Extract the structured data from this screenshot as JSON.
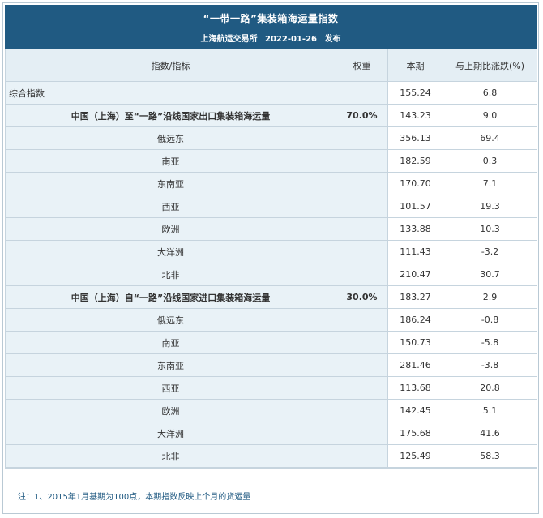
{
  "header": {
    "title": "“一带一路”集装箱海运量指数",
    "publisher": "上海航运交易所",
    "date": "2022-01-26",
    "action": "发布"
  },
  "table": {
    "columns": [
      "指数/指标",
      "权重",
      "本期",
      "与上期比涨跌(%)"
    ],
    "composite": {
      "name": "综合指数",
      "value": "155.24",
      "change": "6.8"
    },
    "groups": [
      {
        "name": "中国（上海）至“一路”沿线国家出口集装箱海运量",
        "weight": "70.0%",
        "value": "143.23",
        "change": "9.0",
        "rows": [
          {
            "name": "俄远东",
            "value": "356.13",
            "change": "69.4"
          },
          {
            "name": "南亚",
            "value": "182.59",
            "change": "0.3"
          },
          {
            "name": "东南亚",
            "value": "170.70",
            "change": "7.1"
          },
          {
            "name": "西亚",
            "value": "101.57",
            "change": "19.3"
          },
          {
            "name": "欧洲",
            "value": "133.88",
            "change": "10.3"
          },
          {
            "name": "大洋洲",
            "value": "111.43",
            "change": "-3.2"
          },
          {
            "name": "北非",
            "value": "210.47",
            "change": "30.7"
          }
        ]
      },
      {
        "name": "中国（上海）自“一路”沿线国家进口集装箱海运量",
        "weight": "30.0%",
        "value": "183.27",
        "change": "2.9",
        "rows": [
          {
            "name": "俄远东",
            "value": "186.24",
            "change": "-0.8"
          },
          {
            "name": "南亚",
            "value": "150.73",
            "change": "-5.8"
          },
          {
            "name": "东南亚",
            "value": "281.46",
            "change": "-3.8"
          },
          {
            "name": "西亚",
            "value": "113.68",
            "change": "20.8"
          },
          {
            "name": "欧洲",
            "value": "142.45",
            "change": "5.1"
          },
          {
            "name": "大洋洲",
            "value": "175.68",
            "change": "41.6"
          },
          {
            "name": "北非",
            "value": "125.49",
            "change": "58.3"
          }
        ]
      }
    ]
  },
  "footer": {
    "note": "注：1、2015年1月基期为100点，本期指数反映上个月的货运量"
  },
  "colors": {
    "header_bg": "#205a82",
    "shade_bg": "#e9f2f7",
    "border": "#c6d4de",
    "note_text": "#205a82"
  }
}
